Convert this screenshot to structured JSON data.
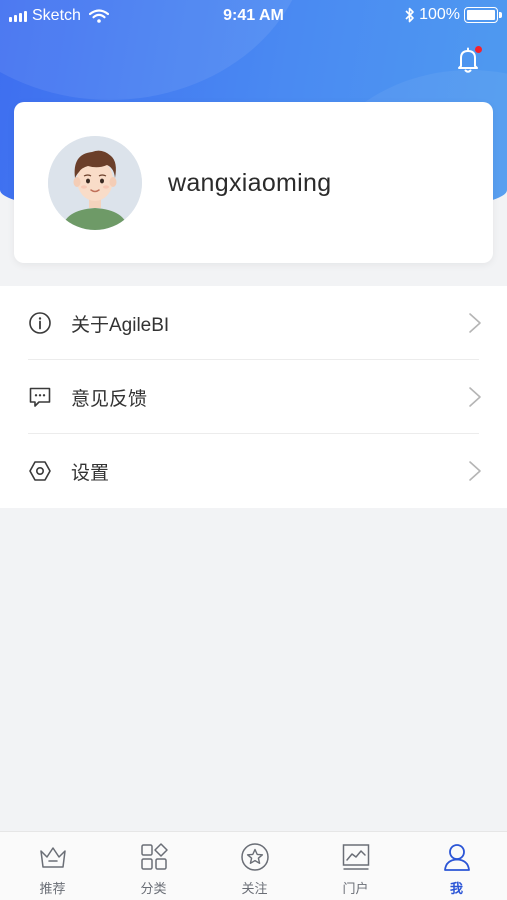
{
  "status_bar": {
    "carrier": "Sketch",
    "time": "9:41 AM",
    "battery": "100%"
  },
  "header": {
    "notification_dot": true,
    "notification_dot_color": "#f5222d"
  },
  "profile": {
    "username": "wangxiaoming"
  },
  "menu": {
    "items": [
      {
        "label": "关于AgileBI",
        "icon": "info-icon"
      },
      {
        "label": "意见反馈",
        "icon": "feedback-icon"
      },
      {
        "label": "设置",
        "icon": "settings-icon"
      }
    ]
  },
  "tabbar": {
    "tabs": [
      {
        "label": "推荐",
        "icon": "crown-icon",
        "active": false
      },
      {
        "label": "分类",
        "icon": "category-icon",
        "active": false
      },
      {
        "label": "关注",
        "icon": "star-icon",
        "active": false
      },
      {
        "label": "门户",
        "icon": "chart-icon",
        "active": false
      },
      {
        "label": "我",
        "icon": "user-icon",
        "active": true
      }
    ]
  },
  "colors": {
    "accent": "#2b55d6",
    "header_gradient_start": "#3e6ef0",
    "header_gradient_end": "#4f9bf0",
    "page_background": "#f2f3f5"
  }
}
